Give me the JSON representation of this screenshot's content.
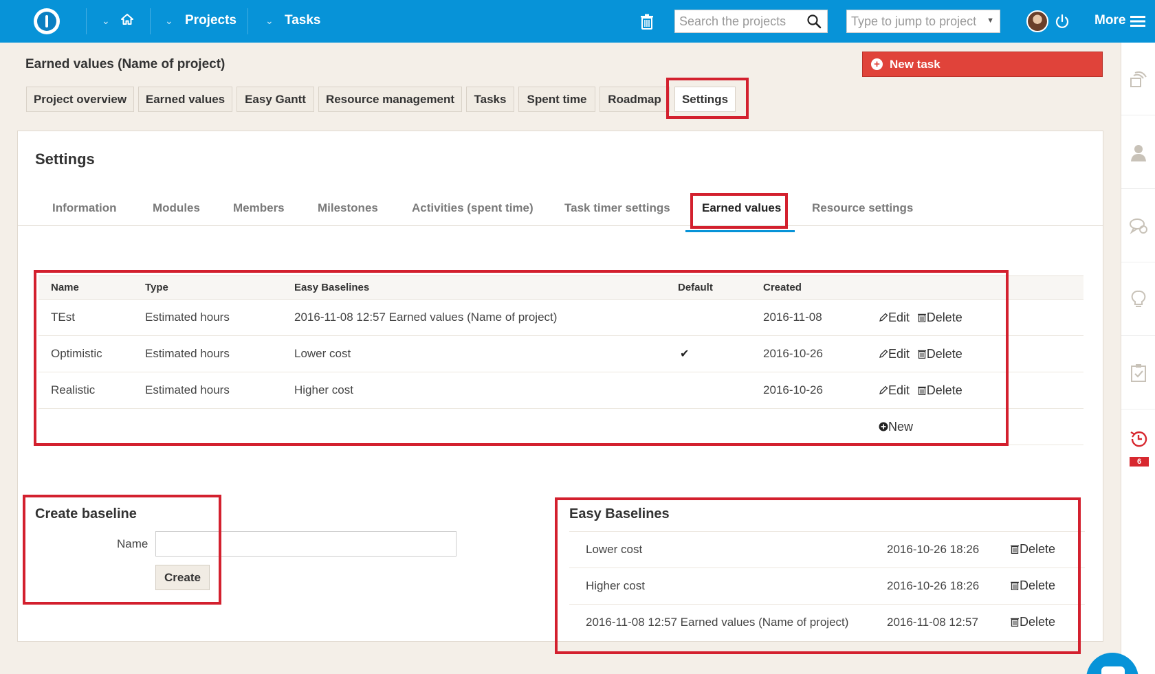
{
  "topbar": {
    "projects_label": "Projects",
    "tasks_label": "Tasks",
    "search_placeholder": "Search the projects",
    "jump_placeholder": "Type to jump to project",
    "more_label": "More",
    "accent_color": "#0793d8"
  },
  "header": {
    "project_title": "Earned values (Name of project)",
    "new_task_label": "New task",
    "tabs": [
      {
        "label": "Project overview"
      },
      {
        "label": "Earned values"
      },
      {
        "label": "Easy Gantt"
      },
      {
        "label": "Resource management"
      },
      {
        "label": "Tasks"
      },
      {
        "label": "Spent time"
      },
      {
        "label": "Roadmap"
      },
      {
        "label": "Settings",
        "active": true
      }
    ]
  },
  "settings": {
    "title": "Settings",
    "tabs": [
      {
        "label": "Information"
      },
      {
        "label": "Modules"
      },
      {
        "label": "Members"
      },
      {
        "label": "Milestones"
      },
      {
        "label": "Activities (spent time)"
      },
      {
        "label": "Task timer settings"
      },
      {
        "label": "Earned values",
        "active": true
      },
      {
        "label": "Resource settings"
      }
    ]
  },
  "earned_values_table": {
    "columns": [
      "Name",
      "Type",
      "Easy Baselines",
      "Default",
      "Created"
    ],
    "rows": [
      {
        "name": "TEst",
        "type": "Estimated hours",
        "baseline": "2016-11-08 12:57 Earned values (Name of project)",
        "default": false,
        "created": "2016-11-08"
      },
      {
        "name": "Optimistic",
        "type": "Estimated hours",
        "baseline": "Lower cost",
        "default": true,
        "created": "2016-10-26"
      },
      {
        "name": "Realistic",
        "type": "Estimated hours",
        "baseline": "Higher cost",
        "default": false,
        "created": "2016-10-26"
      }
    ],
    "edit_label": "Edit",
    "delete_label": "Delete",
    "new_label": "New"
  },
  "create_baseline": {
    "title": "Create baseline",
    "name_label": "Name",
    "name_value": "",
    "create_label": "Create"
  },
  "easy_baselines": {
    "title": "Easy Baselines",
    "delete_label": "Delete",
    "items": [
      {
        "name": "Lower cost",
        "date": "2016-10-26 18:26"
      },
      {
        "name": "Higher cost",
        "date": "2016-10-26 18:26"
      },
      {
        "name": "2016-11-08 12:57 Earned values (Name of project)",
        "date": "2016-11-08 12:57"
      }
    ]
  },
  "sidebar": {
    "icons": [
      "activity-feed-icon",
      "user-icon",
      "chat-icon",
      "lightbulb-icon",
      "checklist-icon",
      "timer-icon"
    ],
    "timer_badge": "6"
  },
  "highlight_color": "#d3202e"
}
